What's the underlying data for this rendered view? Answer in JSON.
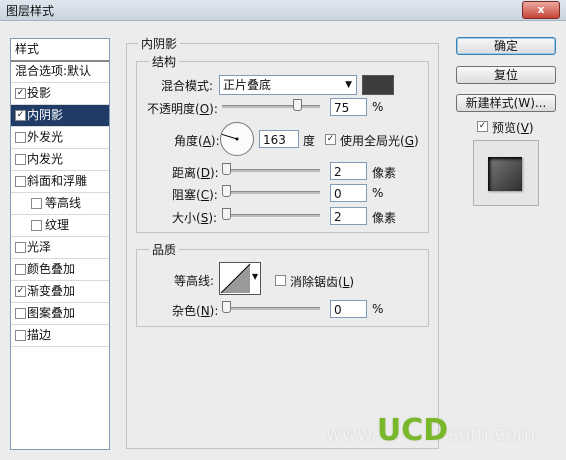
{
  "window": {
    "title": "图层样式",
    "close": "x"
  },
  "left_list": {
    "header": "样式",
    "items": [
      {
        "label": "混合选项:默认",
        "kind": "plain",
        "checked": null
      },
      {
        "label": "投影",
        "kind": "item",
        "checked": true
      },
      {
        "label": "内阴影",
        "kind": "item",
        "checked": true,
        "selected": true
      },
      {
        "label": "外发光",
        "kind": "item",
        "checked": false
      },
      {
        "label": "内发光",
        "kind": "item",
        "checked": false
      },
      {
        "label": "斜面和浮雕",
        "kind": "item",
        "checked": false
      },
      {
        "label": "等高线",
        "kind": "sub",
        "checked": false
      },
      {
        "label": "纹理",
        "kind": "sub",
        "checked": false
      },
      {
        "label": "光泽",
        "kind": "item",
        "checked": false
      },
      {
        "label": "颜色叠加",
        "kind": "item",
        "checked": false
      },
      {
        "label": "渐变叠加",
        "kind": "item",
        "checked": true
      },
      {
        "label": "图案叠加",
        "kind": "item",
        "checked": false
      },
      {
        "label": "描边",
        "kind": "item",
        "checked": false
      }
    ]
  },
  "panel": {
    "title": "内阴影"
  },
  "structure": {
    "title": "结构",
    "blend_mode_label": "混合模式:",
    "blend_mode_value": "正片叠底",
    "opacity_label": "不透明度(",
    "opacity_key": "O",
    "opacity_value": "75",
    "opacity_unit": "%",
    "opacity_fraction": 0.75,
    "angle_label": "角度(",
    "angle_key": "A",
    "angle_value": "163",
    "angle_unit": "度",
    "global_light_label": "使用全局光(",
    "global_light_key": "G",
    "global_light_checked": true,
    "distance_label": "距离(",
    "distance_key": "D",
    "distance_value": "2",
    "distance_unit": "像素",
    "choke_label": "阻塞(",
    "choke_key": "C",
    "choke_value": "0",
    "choke_unit": "%",
    "size_label": "大小(",
    "size_key": "S",
    "size_value": "2",
    "size_unit": "像素",
    "shadow_color": "#3c3c3c"
  },
  "quality": {
    "title": "品质",
    "contour_label": "等高线:",
    "antialias_label": "消除锯齿(",
    "antialias_key": "L",
    "antialias_checked": false,
    "noise_label": "杂色(",
    "noise_key": "N",
    "noise_value": "0",
    "noise_unit": "%"
  },
  "buttons": {
    "ok": "确定",
    "reset": "复位",
    "new_style": "新建样式(W)...",
    "preview_label": "预览(",
    "preview_key": "V",
    "preview_checked": true
  },
  "watermark": {
    "prefix": "www.",
    "brand": "UCD",
    "suffix": "com.com"
  }
}
